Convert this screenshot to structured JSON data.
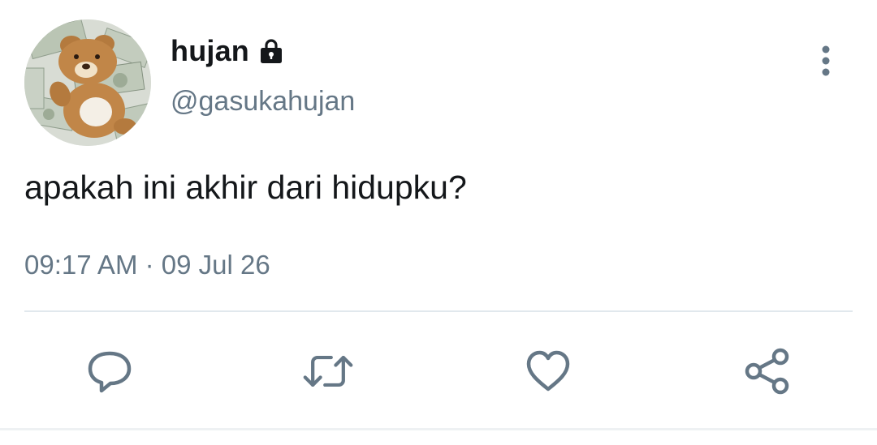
{
  "user": {
    "display_name": "hujan",
    "handle": "@gasukahujan",
    "protected_icon": "lock-icon"
  },
  "tweet": {
    "text": "apakah ini akhir dari hidupku?",
    "time": "09:17 AM",
    "separator": "·",
    "date": "09 Jul 26"
  },
  "actions": [
    {
      "name": "reply",
      "icon": "comment-icon"
    },
    {
      "name": "retweet",
      "icon": "retweet-icon"
    },
    {
      "name": "like",
      "icon": "heart-icon"
    },
    {
      "name": "share",
      "icon": "share-icon"
    }
  ],
  "menu": {
    "icon": "more-vertical-icon"
  },
  "colors": {
    "text_primary": "#14171a",
    "text_secondary": "#657786",
    "divider": "#e1e8ed"
  }
}
